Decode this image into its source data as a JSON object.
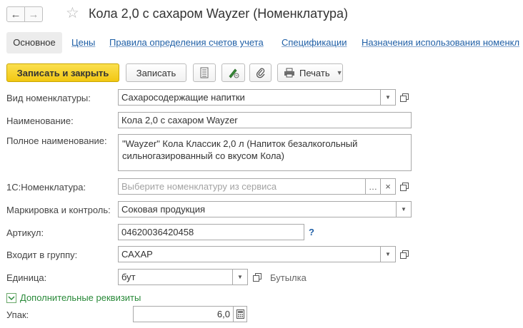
{
  "title": "Кола 2,0 с сахаром Wayzer (Номенклатура)",
  "tabs": [
    {
      "label": "Основное"
    },
    {
      "label": "Цены"
    },
    {
      "label": "Правила определения счетов учета"
    },
    {
      "label": "Спецификации"
    },
    {
      "label": "Назначения использования номенкл"
    }
  ],
  "toolbar": {
    "save_close_label": "Записать и закрыть",
    "save_label": "Записать",
    "print_label": "Печать"
  },
  "form": {
    "vid": {
      "label": "Вид номенклатуры:",
      "value": "Сахаросодержащие напитки"
    },
    "name": {
      "label": "Наименование:",
      "value": "Кола 2,0 с сахаром Wayzer"
    },
    "full_name": {
      "label": "Полное наименование:",
      "line1": "\"Wayzer\" Кола Классик 2,0 л  (Напиток безалкогольный",
      "line2": "сильногазированный со вкусом Кола)"
    },
    "nomenclature_1c": {
      "label": "1С:Номенклатура:",
      "placeholder": "Выберите номенклатуру из сервиса"
    },
    "marking": {
      "label": "Маркировка и контроль:",
      "value": "Соковая продукция"
    },
    "article": {
      "label": "Артикул:",
      "value": "04620036420458",
      "help": "?"
    },
    "group": {
      "label": "Входит в группу:",
      "value": "САХАР"
    },
    "unit": {
      "label": "Единица:",
      "value": "бут",
      "unit_name": "Бутылка"
    },
    "extra_group": {
      "label": "Дополнительные реквизиты"
    },
    "pack": {
      "label": "Упак:",
      "value": "6,0"
    }
  },
  "icons": {
    "back": "arrow-left-icon",
    "forward": "arrow-right-icon",
    "favorite": "star-icon"
  }
}
